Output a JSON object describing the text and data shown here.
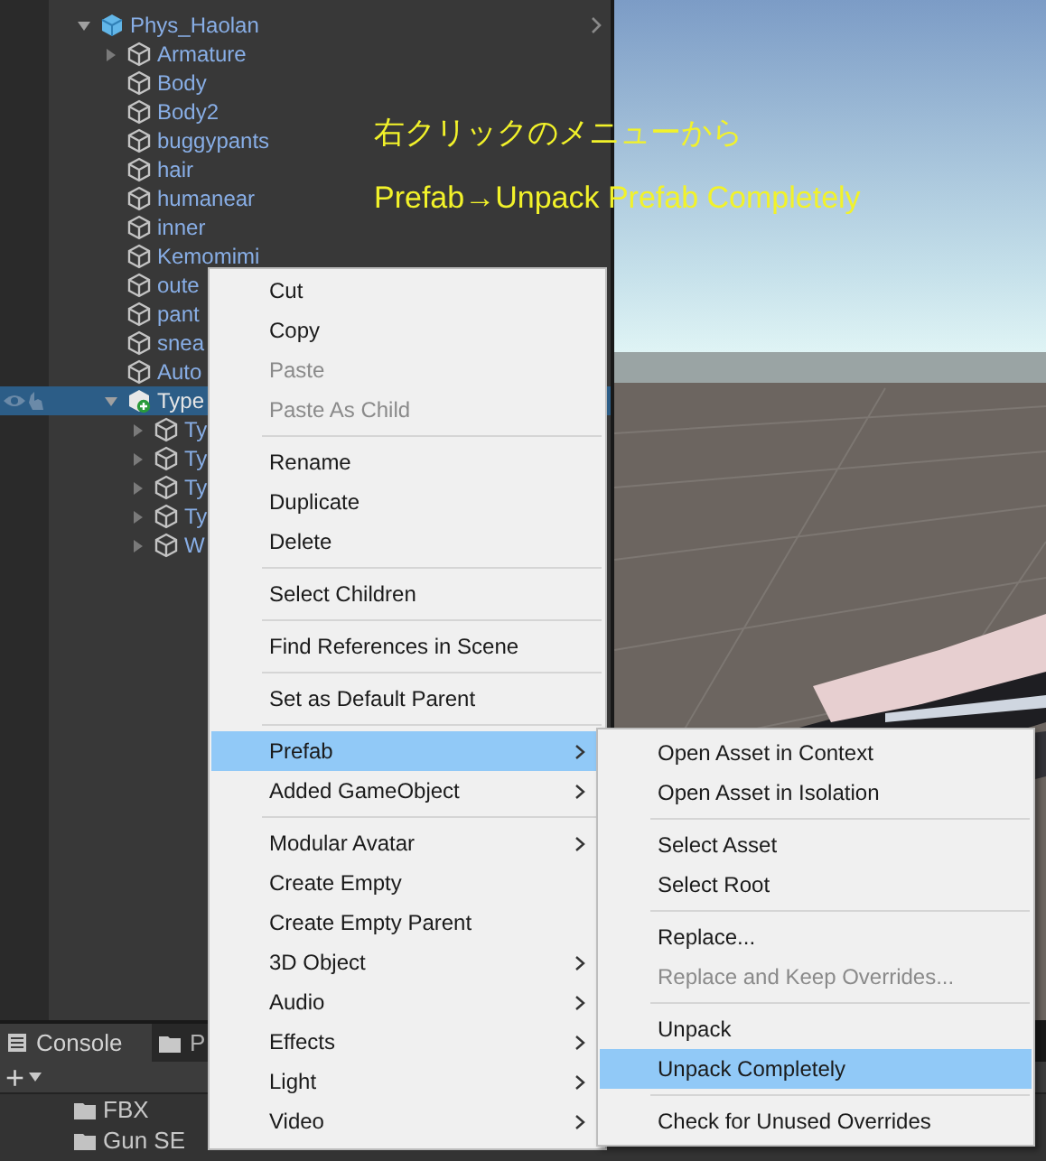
{
  "hierarchy": {
    "items": [
      {
        "label": "Phys_Haolan",
        "kind": "prefab",
        "expanded": true,
        "selected": false,
        "children": [
          {
            "label": "Armature",
            "kind": "object",
            "expanded": false,
            "selected": false,
            "has_children": true
          },
          {
            "label": "Body",
            "kind": "object",
            "selected": false
          },
          {
            "label": "Body2",
            "kind": "object",
            "selected": false
          },
          {
            "label": "buggypants",
            "kind": "object",
            "selected": false
          },
          {
            "label": "hair",
            "kind": "object",
            "selected": false
          },
          {
            "label": "humanear",
            "kind": "object",
            "selected": false
          },
          {
            "label": "inner",
            "kind": "object",
            "selected": false
          },
          {
            "label": "Kemomimi",
            "kind": "object",
            "selected": false
          },
          {
            "label": "oute",
            "kind": "object",
            "selected": false
          },
          {
            "label": "pant",
            "kind": "object",
            "selected": false
          },
          {
            "label": "snea",
            "kind": "object",
            "selected": false
          },
          {
            "label": "Auto",
            "kind": "object",
            "selected": false
          },
          {
            "label": "Type",
            "kind": "added",
            "expanded": true,
            "selected": true,
            "children": [
              {
                "label": "Ty",
                "kind": "object",
                "expanded": false,
                "selected": false,
                "has_children": true
              },
              {
                "label": "Ty",
                "kind": "object",
                "expanded": false,
                "selected": false,
                "has_children": true
              },
              {
                "label": "Ty",
                "kind": "object",
                "expanded": false,
                "selected": false,
                "has_children": true
              },
              {
                "label": "Ty",
                "kind": "object",
                "expanded": false,
                "selected": false,
                "has_children": true
              },
              {
                "label": "W",
                "kind": "object",
                "expanded": false,
                "selected": false,
                "has_children": true
              }
            ]
          }
        ]
      }
    ]
  },
  "annotation": [
    "右クリックのメニューから",
    "Prefab→Unpack Prefab Completely"
  ],
  "context_menu": {
    "items": [
      {
        "kind": "item",
        "label": "Cut",
        "disabled": false,
        "submenu": false,
        "selected": false
      },
      {
        "kind": "item",
        "label": "Copy",
        "disabled": false,
        "submenu": false,
        "selected": false
      },
      {
        "kind": "item",
        "label": "Paste",
        "disabled": true,
        "submenu": false,
        "selected": false
      },
      {
        "kind": "item",
        "label": "Paste As Child",
        "disabled": true,
        "submenu": false,
        "selected": false
      },
      {
        "kind": "separator"
      },
      {
        "kind": "item",
        "label": "Rename",
        "disabled": false,
        "submenu": false,
        "selected": false
      },
      {
        "kind": "item",
        "label": "Duplicate",
        "disabled": false,
        "submenu": false,
        "selected": false
      },
      {
        "kind": "item",
        "label": "Delete",
        "disabled": false,
        "submenu": false,
        "selected": false
      },
      {
        "kind": "separator"
      },
      {
        "kind": "item",
        "label": "Select Children",
        "disabled": false,
        "submenu": false,
        "selected": false
      },
      {
        "kind": "separator"
      },
      {
        "kind": "item",
        "label": "Find References in Scene",
        "disabled": false,
        "submenu": false,
        "selected": false
      },
      {
        "kind": "separator"
      },
      {
        "kind": "item",
        "label": "Set as Default Parent",
        "disabled": false,
        "submenu": false,
        "selected": false
      },
      {
        "kind": "separator"
      },
      {
        "kind": "item",
        "label": "Prefab",
        "disabled": false,
        "submenu": true,
        "selected": true
      },
      {
        "kind": "item",
        "label": "Added GameObject",
        "disabled": false,
        "submenu": true,
        "selected": false
      },
      {
        "kind": "separator"
      },
      {
        "kind": "item",
        "label": "Modular Avatar",
        "disabled": false,
        "submenu": true,
        "selected": false
      },
      {
        "kind": "item",
        "label": "Create Empty",
        "disabled": false,
        "submenu": false,
        "selected": false
      },
      {
        "kind": "item",
        "label": "Create Empty Parent",
        "disabled": false,
        "submenu": false,
        "selected": false
      },
      {
        "kind": "item",
        "label": "3D Object",
        "disabled": false,
        "submenu": true,
        "selected": false
      },
      {
        "kind": "item",
        "label": "Audio",
        "disabled": false,
        "submenu": true,
        "selected": false
      },
      {
        "kind": "item",
        "label": "Effects",
        "disabled": false,
        "submenu": true,
        "selected": false
      },
      {
        "kind": "item",
        "label": "Light",
        "disabled": false,
        "submenu": true,
        "selected": false
      },
      {
        "kind": "item",
        "label": "Video",
        "disabled": false,
        "submenu": true,
        "selected": false
      }
    ]
  },
  "prefab_submenu": {
    "items": [
      {
        "kind": "item",
        "label": "Open Asset in Context",
        "disabled": false,
        "selected": false
      },
      {
        "kind": "item",
        "label": "Open Asset in Isolation",
        "disabled": false,
        "selected": false
      },
      {
        "kind": "separator"
      },
      {
        "kind": "item",
        "label": "Select Asset",
        "disabled": false,
        "selected": false
      },
      {
        "kind": "item",
        "label": "Select Root",
        "disabled": false,
        "selected": false
      },
      {
        "kind": "separator"
      },
      {
        "kind": "item",
        "label": "Replace...",
        "disabled": false,
        "selected": false
      },
      {
        "kind": "item",
        "label": "Replace and Keep Overrides...",
        "disabled": true,
        "selected": false
      },
      {
        "kind": "separator"
      },
      {
        "kind": "item",
        "label": "Unpack",
        "disabled": false,
        "selected": false
      },
      {
        "kind": "item",
        "label": "Unpack Completely",
        "disabled": false,
        "selected": true
      },
      {
        "kind": "separator"
      },
      {
        "kind": "item",
        "label": "Check for Unused Overrides",
        "disabled": false,
        "selected": false
      }
    ]
  },
  "bottom_panel": {
    "tabs": [
      {
        "label": "Console",
        "kind": "console",
        "selected": true
      },
      {
        "label": "P",
        "kind": "project",
        "selected": false
      }
    ],
    "toolbar": [
      "+"
    ],
    "folders": [
      "FBX",
      "Gun SE"
    ]
  }
}
